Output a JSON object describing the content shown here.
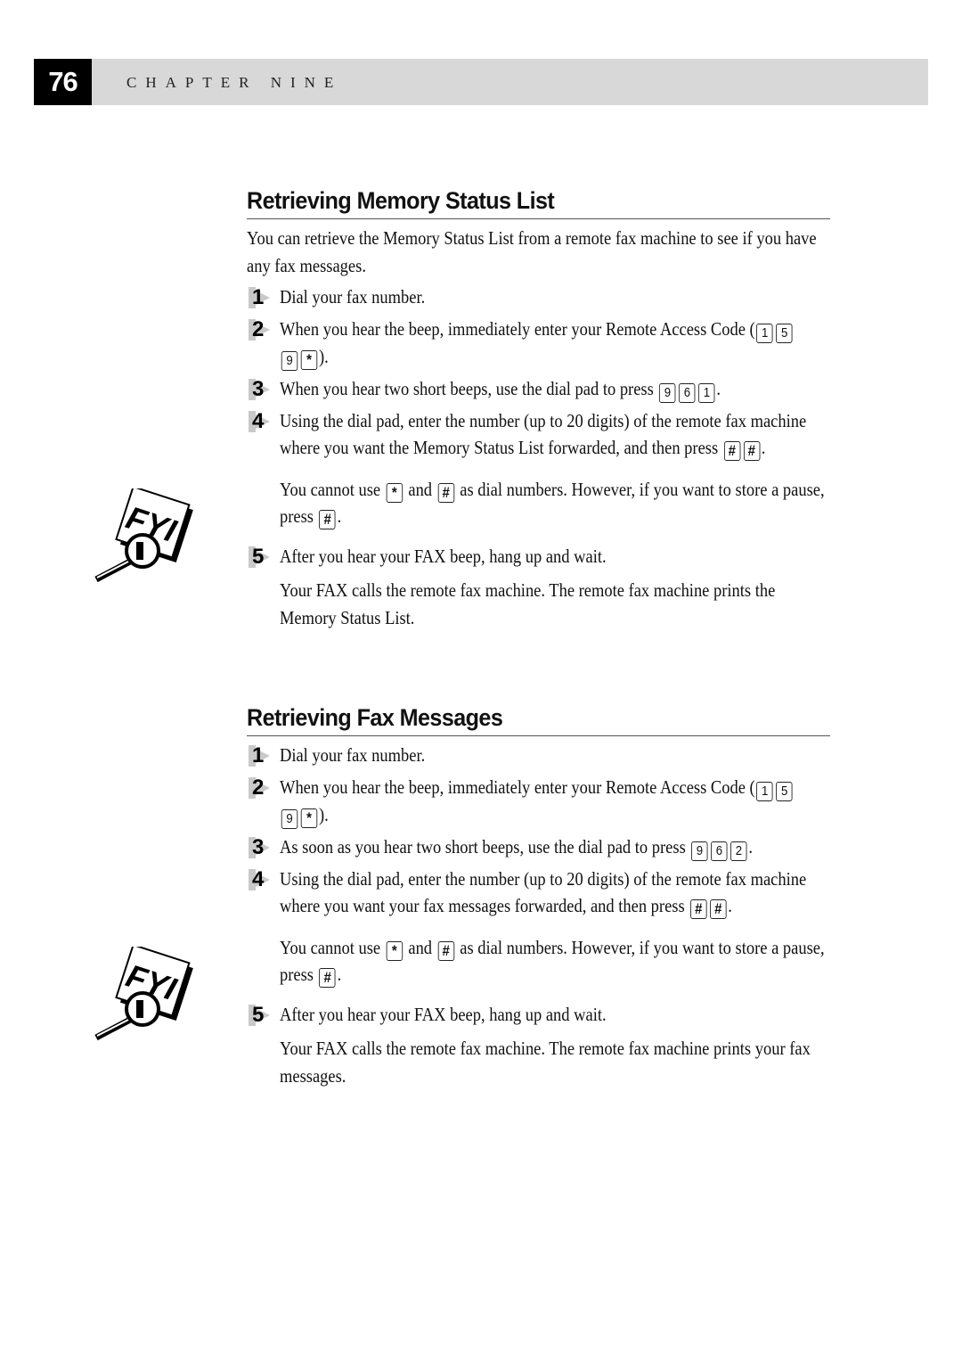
{
  "header": {
    "page_number": "76",
    "chapter": "CHAPTER NINE"
  },
  "sections": [
    {
      "title": "Retrieving Memory Status List",
      "intro": "You can retrieve the Memory Status List from a remote fax machine to see if you have any fax messages.",
      "steps": [
        {
          "num": "1",
          "text": "Dial your fax number."
        },
        {
          "num": "2",
          "text_before": "When you hear the beep, immediately enter your Remote Access Code (",
          "keys": [
            "1",
            "5",
            "9",
            "*"
          ],
          "text_after": ")."
        },
        {
          "num": "3",
          "text_before": "When you hear two short beeps, use the dial pad to press ",
          "keys": [
            "9",
            "6",
            "1"
          ],
          "text_after": "."
        },
        {
          "num": "4",
          "text_before": "Using the dial pad, enter the number (up to 20 digits) of the remote fax machine where you want the Memory Status List forwarded, and then press ",
          "keys": [
            "#",
            "#"
          ],
          "text_after": "."
        },
        {
          "num": "5",
          "text": "After you hear your FAX beep, hang up and wait."
        }
      ],
      "fyi_note": {
        "icon": "fyi-magnifier-icon",
        "text_1": "You cannot use ",
        "key_1": "*",
        "text_2": " and ",
        "key_2": "#",
        "text_3": " as dial numbers.  However, if you want to store a pause, press ",
        "key_3": "#",
        "text_4": "."
      },
      "result": "Your FAX calls the remote fax machine.  The remote fax machine prints the Memory Status List."
    },
    {
      "title": "Retrieving Fax Messages",
      "steps": [
        {
          "num": "1",
          "text": "Dial your fax number."
        },
        {
          "num": "2",
          "text_before": "When you hear the beep, immediately enter your Remote Access Code (",
          "keys": [
            "1",
            "5",
            "9",
            "*"
          ],
          "text_after": ")."
        },
        {
          "num": "3",
          "text_before": "As soon as you hear two short beeps, use the dial pad to press ",
          "keys": [
            "9",
            "6",
            "2"
          ],
          "text_after": "."
        },
        {
          "num": "4",
          "text_before": "Using the dial pad, enter the number (up to 20 digits) of the remote fax machine where you want your fax messages forwarded, and then press ",
          "keys": [
            "#",
            "#"
          ],
          "text_after": "."
        },
        {
          "num": "5",
          "text": "After you hear your FAX beep, hang up and wait."
        }
      ],
      "fyi_note": {
        "icon": "fyi-magnifier-icon",
        "text_1": "You cannot use ",
        "key_1": "*",
        "text_2": " and ",
        "key_2": "#",
        "text_3": " as dial numbers.  However, if you want to store a pause, press ",
        "key_3": "#",
        "text_4": "."
      },
      "result": "Your FAX calls the remote fax machine.  The remote fax machine prints your fax messages."
    }
  ]
}
